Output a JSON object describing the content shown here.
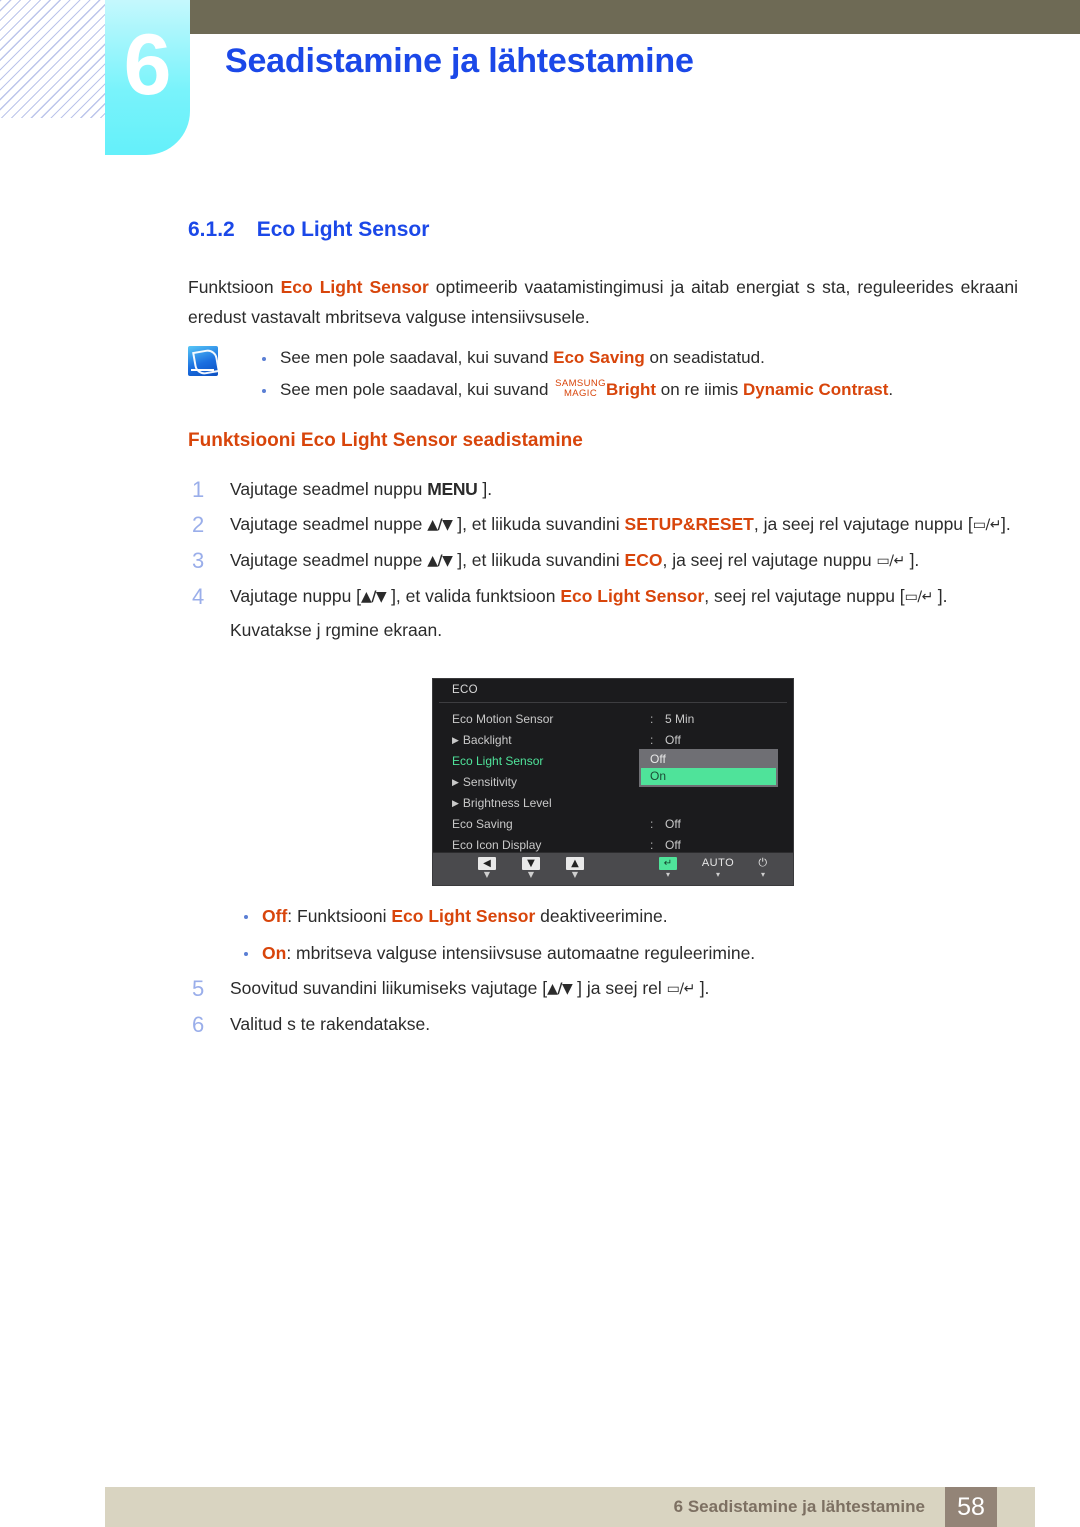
{
  "header": {
    "chapter_number": "6",
    "chapter_title": "Seadistamine ja lähtestamine"
  },
  "section": {
    "number": "6.1.2",
    "title": "Eco Light Sensor"
  },
  "intro": {
    "t1": "Funktsioon ",
    "t2": "Eco Light Sensor",
    "t3": " optimeerib vaatamistingimusi ja aitab energiat s sta, reguleerides ekraani eredust vastavalt  mbritseva valguse intensiivsusele."
  },
  "note": {
    "icon": "note-pen-icon",
    "items": [
      {
        "a": "See men  pole saadaval, kui suvand ",
        "b": "Eco Saving",
        "c": " on seadistatud.",
        "has_magic": false
      },
      {
        "a": "See men  pole saadaval, kui suvand ",
        "magic_top": "SAMSUNG",
        "magic_bottom": "MAGIC",
        "b": "Bright",
        "c": " on re iimis ",
        "d": "Dynamic Contrast",
        "e": ".",
        "has_magic": true
      }
    ]
  },
  "sub_head": "Funktsiooni Eco Light Sensor seadistamine",
  "steps": [
    {
      "n": "1",
      "a": "Vajutage seadmel nuppu ",
      "key": "MENU",
      "b": " ].",
      "c": "",
      "d": "",
      "e": ""
    },
    {
      "n": "2",
      "a": "Vajutage seadmel nuppe ",
      "key": "▲/▼",
      "b": " ], et liikuda suvandini ",
      "c": "SETUP&RESET",
      "d": ", ja seej rel vajutage nuppu [",
      "e": "▭/↵",
      "f": "]."
    },
    {
      "n": "3",
      "a": "Vajutage seadmel nuppe ",
      "key": "▲/▼",
      "b": " ], et liikuda suvandini ",
      "c": "ECO",
      "d": ", ja seej rel vajutage nuppu ",
      "e": "▭/↵",
      "f": " ]."
    },
    {
      "n": "4",
      "a": "Vajutage nuppu [",
      "key": "▲/▼",
      "b": " ], et valida funktsioon ",
      "c": "Eco Light Sensor",
      "d": ", seej rel vajutage nuppu [",
      "e": "▭/↵",
      "f": " ]. Kuvatakse j rgmine ekraan."
    }
  ],
  "osd": {
    "title": "ECO",
    "rows": [
      {
        "label": "Eco Motion Sensor",
        "arrow": false,
        "colon": ":",
        "value": "5 Min",
        "selected": false
      },
      {
        "label": "Backlight",
        "arrow": true,
        "colon": ":",
        "value": "Off",
        "selected": false
      },
      {
        "label": "Eco Light Sensor",
        "arrow": false,
        "colon": ":",
        "value": "",
        "selected": true
      },
      {
        "label": "Sensitivity",
        "arrow": true,
        "colon": "",
        "value": "",
        "selected": false
      },
      {
        "label": "Brightness Level",
        "arrow": true,
        "colon": "",
        "value": "",
        "selected": false
      },
      {
        "label": "Eco Saving",
        "arrow": false,
        "colon": ":",
        "value": "Off",
        "selected": false
      },
      {
        "label": "Eco Icon Display",
        "arrow": false,
        "colon": ":",
        "value": "Off",
        "selected": false
      }
    ],
    "popup": {
      "options": [
        {
          "label": "Off",
          "active": false
        },
        {
          "label": "On",
          "active": true
        }
      ]
    },
    "toolbar": [
      {
        "glyph": "◀",
        "sub": "▼",
        "kind": "box"
      },
      {
        "glyph": "▼",
        "sub": "▼",
        "kind": "box"
      },
      {
        "glyph": "▲",
        "sub": "▼",
        "kind": "box"
      },
      {
        "glyph": "↵",
        "sub": "▾",
        "kind": "box-green"
      },
      {
        "glyph": "AUTO",
        "sub": "▾",
        "kind": "text"
      },
      {
        "glyph": "⏻",
        "sub": "▾",
        "kind": "text"
      }
    ],
    "colors": {
      "background": "#1b1b1d",
      "selected_text": "#4fe39a",
      "highlight": "#4fe39a",
      "toolbar_bg": "#4a4a4d"
    }
  },
  "osd_bullets": [
    {
      "a": "Off",
      "b": ": Funktsiooni ",
      "c": "Eco Light Sensor",
      "d": " deaktiveerimine."
    },
    {
      "a": "On",
      "b": ":  mbritseva valguse intensiivsuse automaatne reguleerimine.",
      "c": "",
      "d": ""
    }
  ],
  "steps2": [
    {
      "n": "5",
      "a": "Soovitud suvandini liikumiseks vajutage [",
      "key": "▲/▼",
      "b": " ] ja seej rel ",
      "e": "▭/↵",
      "f": " ]."
    },
    {
      "n": "6",
      "a": "Valitud s te rakendatakse.",
      "key": "",
      "b": "",
      "e": "",
      "f": ""
    }
  ],
  "footer": {
    "text": "6 Seadistamine ja lähtestamine",
    "page": "58"
  },
  "colors": {
    "chapter_blue": "#1b48e8",
    "tab_cyan": "#79f3fb",
    "olive": "#6e6a55",
    "orange": "#d8450b",
    "step_number": "#9aaeea",
    "footer_bg": "#d9d4c1",
    "footer_page_bg": "#938477"
  }
}
